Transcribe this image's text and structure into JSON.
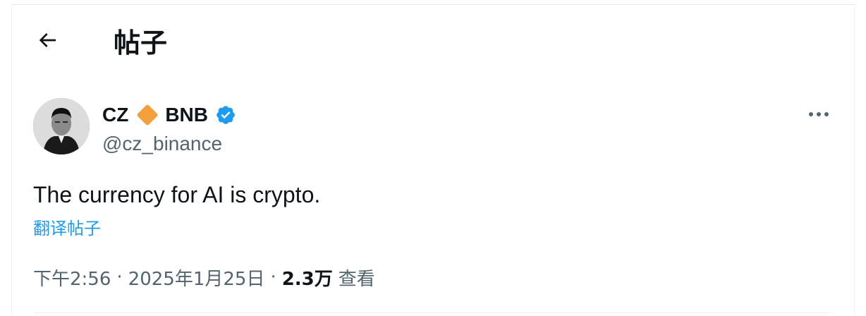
{
  "header": {
    "title": "帖子",
    "back_icon": "arrow-left-icon"
  },
  "author": {
    "name_part1": "CZ",
    "name_emoji": "diamond-orange-icon",
    "name_part2": "BNB",
    "verified_icon": "verified-badge-icon",
    "handle": "@cz_binance"
  },
  "more_icon": "more-horizontal-icon",
  "post": {
    "text": "The currency for AI is crypto.",
    "translate_label": "翻译帖子"
  },
  "meta": {
    "time": "下午2:56",
    "separator": "·",
    "date": "2025年1月25日",
    "views_count": "2.3万",
    "views_label": "查看"
  },
  "colors": {
    "accent": "#1d9bf0",
    "text_primary": "#0f1419",
    "text_secondary": "#536471",
    "diamond": "#f3a03c"
  }
}
